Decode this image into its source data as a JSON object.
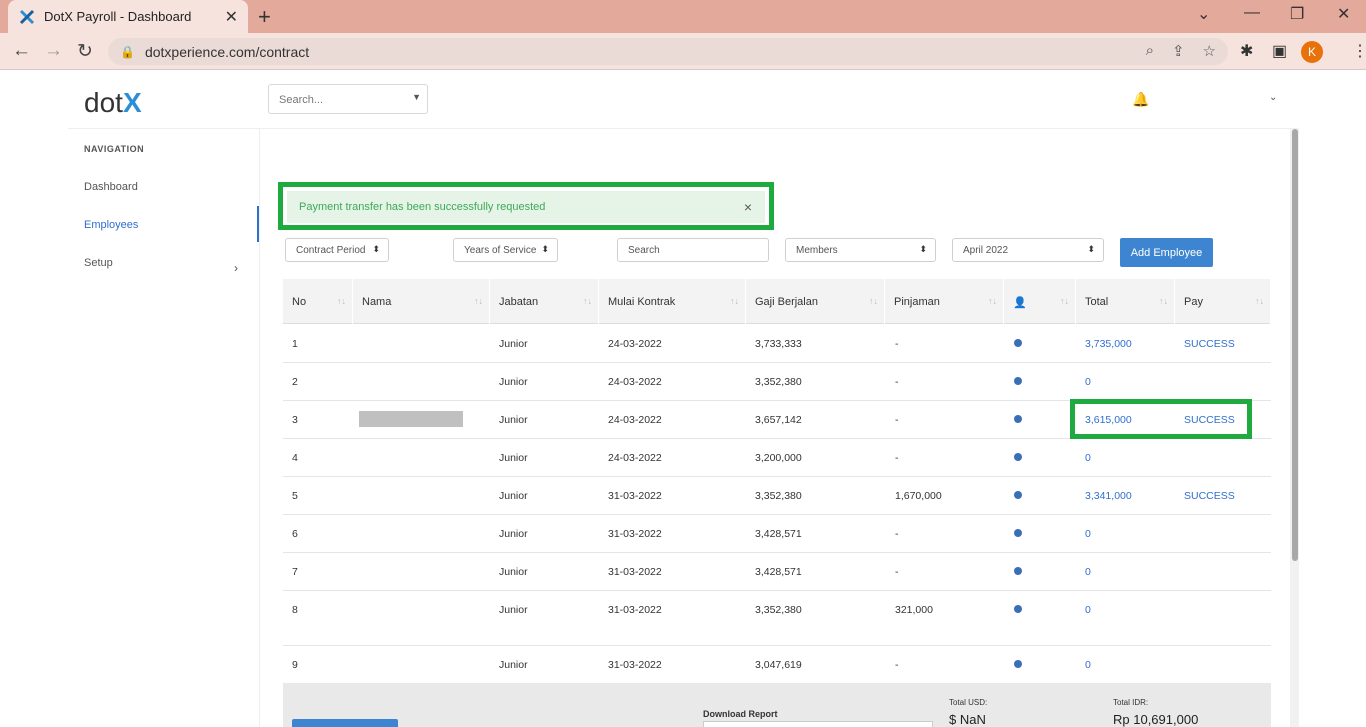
{
  "browser": {
    "tab_title": "DotX Payroll - Dashboard",
    "url": "dotxperience.com/contract",
    "profile_initial": "K"
  },
  "app": {
    "logo_text": "dot",
    "logo_x": "X",
    "search_placeholder": "Search...",
    "accent": "#2f6fce"
  },
  "sidebar": {
    "title": "NAVIGATION",
    "items": [
      {
        "label": "Dashboard"
      },
      {
        "label": "Employees"
      },
      {
        "label": "Setup"
      }
    ]
  },
  "alert": {
    "message": "Payment transfer has been successfully requested",
    "close": "×"
  },
  "filters": {
    "contract_period": "Contract Period",
    "years_of_service": "Years of Service",
    "search_placeholder": "Search",
    "members": "Members",
    "month": "April 2022",
    "add_employee": "Add Employee"
  },
  "table": {
    "headers": [
      "No",
      "Nama",
      "Jabatan",
      "Mulai Kontrak",
      "Gaji Berjalan",
      "Pinjaman",
      "",
      "Total",
      "Pay"
    ],
    "rows": [
      {
        "no": "1",
        "nama": "",
        "jabatan": "Junior",
        "mulai": "24-03-2022",
        "gaji": "3,733,333",
        "pinjaman": "-",
        "total": "3,735,000",
        "pay": "SUCCESS"
      },
      {
        "no": "2",
        "nama": "",
        "jabatan": "Junior",
        "mulai": "24-03-2022",
        "gaji": "3,352,380",
        "pinjaman": "-",
        "total": "0",
        "pay": ""
      },
      {
        "no": "3",
        "nama": "",
        "jabatan": "Junior",
        "mulai": "24-03-2022",
        "gaji": "3,657,142",
        "pinjaman": "-",
        "total": "3,615,000",
        "pay": "SUCCESS"
      },
      {
        "no": "4",
        "nama": "",
        "jabatan": "Junior",
        "mulai": "24-03-2022",
        "gaji": "3,200,000",
        "pinjaman": "-",
        "total": "0",
        "pay": ""
      },
      {
        "no": "5",
        "nama": "",
        "jabatan": "Junior",
        "mulai": "31-03-2022",
        "gaji": "3,352,380",
        "pinjaman": "1,670,000",
        "total": "3,341,000",
        "pay": "SUCCESS"
      },
      {
        "no": "6",
        "nama": "",
        "jabatan": "Junior",
        "mulai": "31-03-2022",
        "gaji": "3,428,571",
        "pinjaman": "-",
        "total": "0",
        "pay": ""
      },
      {
        "no": "7",
        "nama": "",
        "jabatan": "Junior",
        "mulai": "31-03-2022",
        "gaji": "3,428,571",
        "pinjaman": "-",
        "total": "0",
        "pay": ""
      },
      {
        "no": "8",
        "nama": "",
        "jabatan": "Junior",
        "mulai": "31-03-2022",
        "gaji": "3,352,380",
        "pinjaman": "321,000",
        "total": "0",
        "pay": ""
      },
      {
        "no": "9",
        "nama": "",
        "jabatan": "Junior",
        "mulai": "31-03-2022",
        "gaji": "3,047,619",
        "pinjaman": "-",
        "total": "0",
        "pay": ""
      }
    ]
  },
  "footer": {
    "download_label": "Download Report",
    "total_usd_label": "Total USD:",
    "total_usd": "$ NaN",
    "total_idr_label": "Total IDR:",
    "total_idr": "Rp 10,691,000"
  }
}
